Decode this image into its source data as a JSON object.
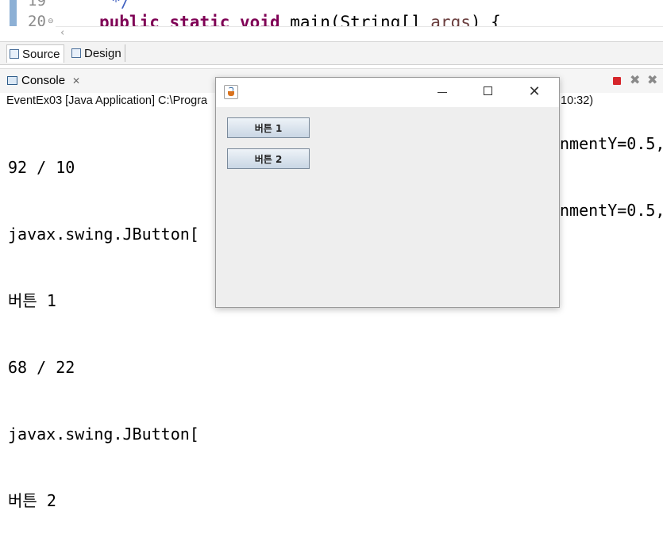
{
  "editor": {
    "line_numbers": [
      "19",
      "20"
    ],
    "comment": "*/",
    "code": {
      "kw1": "public",
      "kw2": "static",
      "kw3": "void",
      "rest": "main(String[] ",
      "arg": "args",
      "end": ") {"
    },
    "scroll_arrow": "‹"
  },
  "editor_tabs": {
    "source": "Source",
    "design": "Design"
  },
  "console": {
    "tab_label": "Console",
    "close_glyph": "✕",
    "description": "EventEx03 [Java Application] C:\\Progra",
    "description_tail": "10:32)",
    "output_lines": [
      "92 / 10",
      "javax.swing.JButton[",
      "버튼 1",
      "68 / 22",
      "javax.swing.JButton[",
      "버튼 2"
    ],
    "output_right": [
      "nmentY=0.5,",
      "nmentY=0.5,"
    ],
    "toolbar": {
      "stop_color": "#d6262b",
      "remove_glyph": "✖",
      "remove_all_glyph": "✖"
    }
  },
  "swing_window": {
    "title": "",
    "icon": "java-icon",
    "minimize_glyph": "",
    "close_glyph": "✕",
    "buttons": [
      "버튼 1",
      "버튼 2"
    ]
  }
}
